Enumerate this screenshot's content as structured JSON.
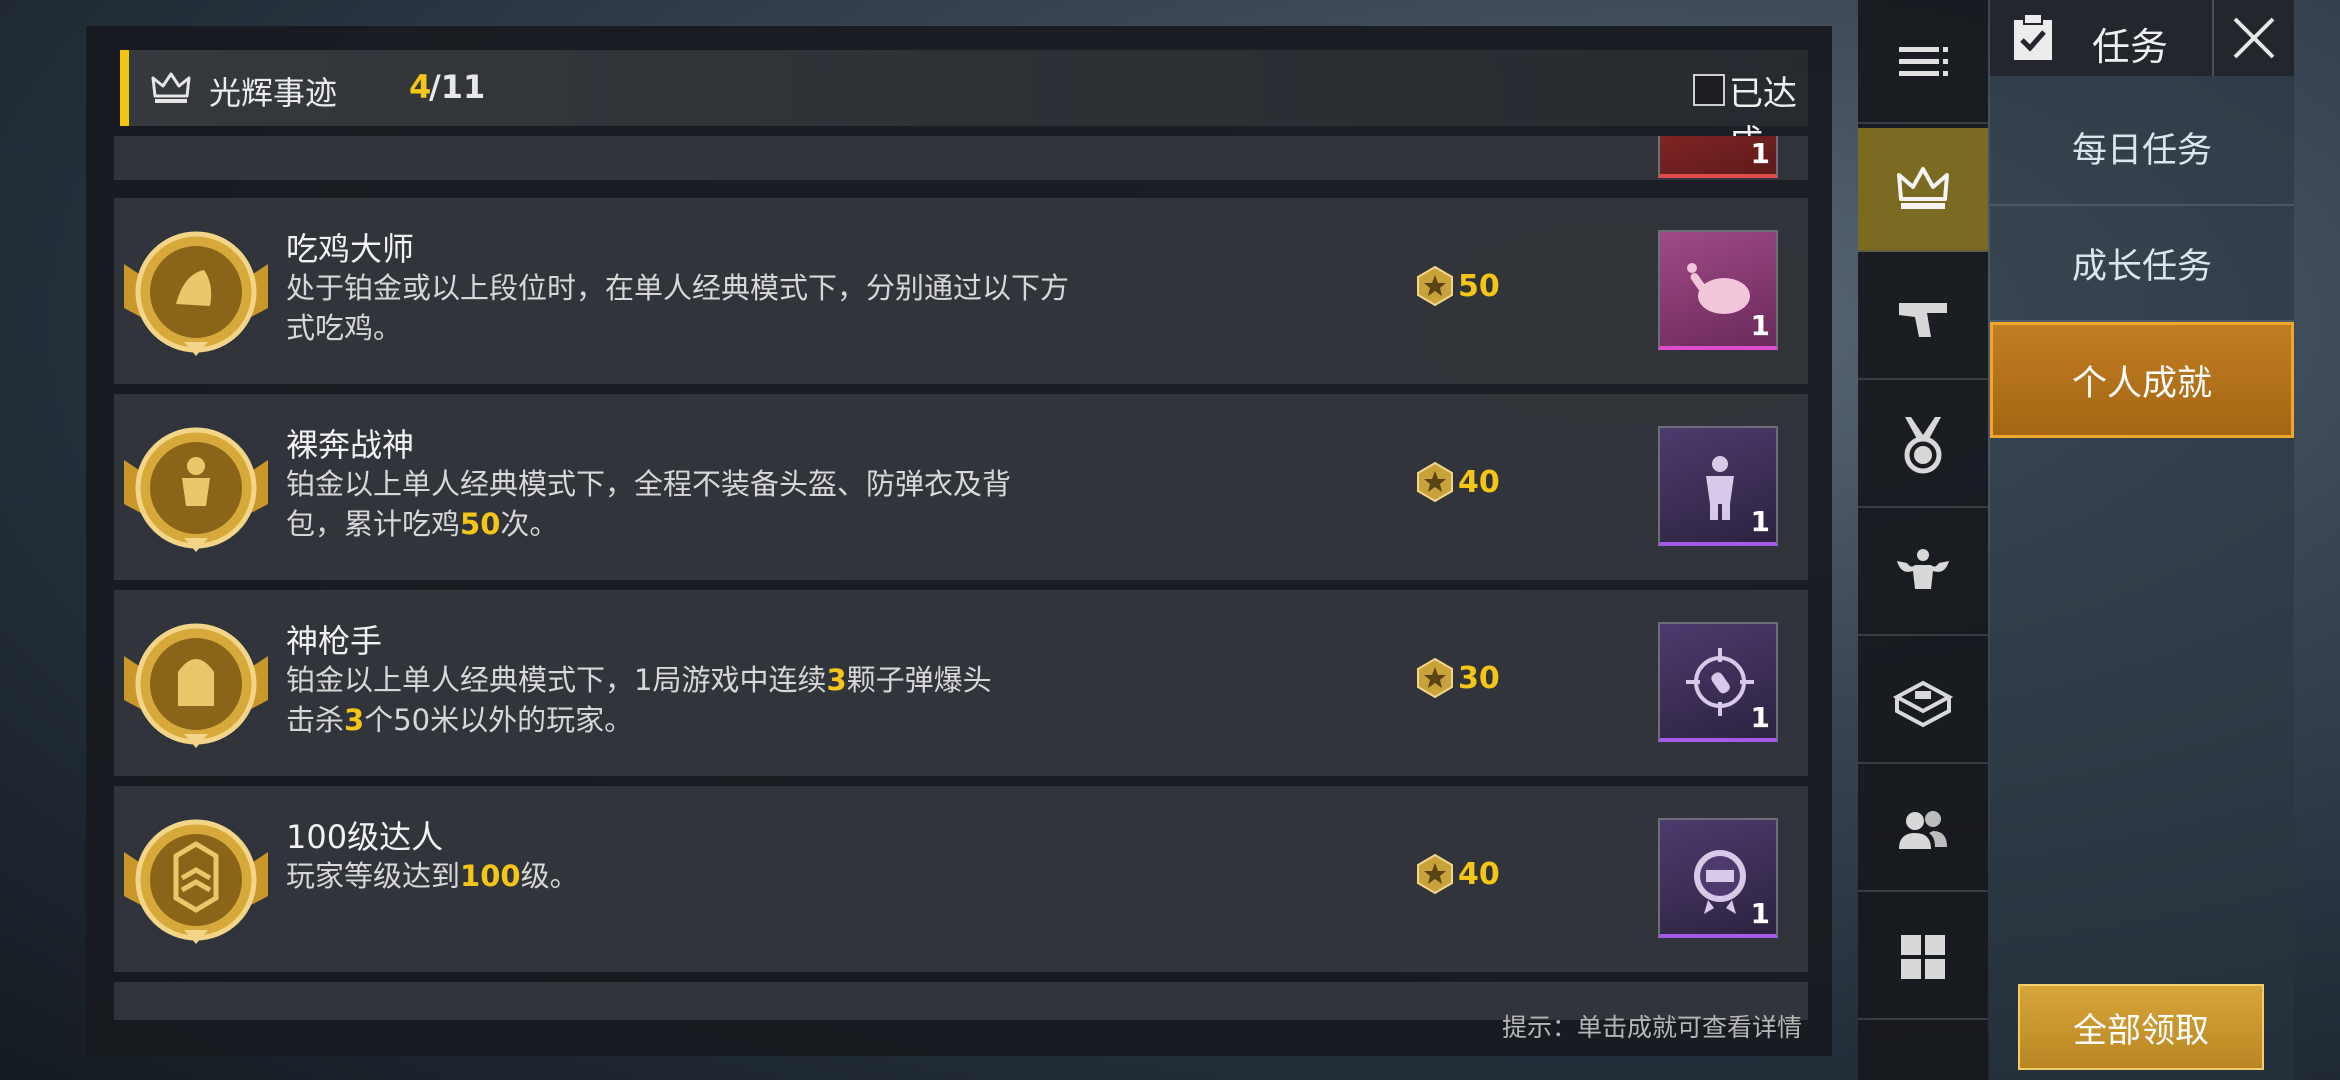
{
  "header": {
    "title": "光辉事迹",
    "progress_current": "4",
    "progress_total": "/11",
    "filter_label": "已达成"
  },
  "achievements": [
    {
      "title": "吃鸡大师",
      "desc_parts": [
        "处于铂金或以上段位时，在单人经典模式下，分别通过以下方式吃鸡。"
      ],
      "points": "50",
      "reward_count": "1",
      "reward_icon": "roast-chicken-icon",
      "reward_color": "#e04bd0"
    },
    {
      "title": "裸奔战神",
      "desc_parts": [
        "铂金以上单人经典模式下，全程不装备头盔、防弹衣及背包，累计吃鸡",
        "50",
        "次。"
      ],
      "points": "40",
      "reward_count": "1",
      "reward_icon": "bare-body-icon",
      "reward_color": "#a55be6"
    },
    {
      "title": "神枪手",
      "desc_parts": [
        "铂金以上单人经典模式下，1局游戏中连续",
        "3",
        "颗子弹爆头击杀",
        "3",
        "个50米以外的玩家。"
      ],
      "points": "30",
      "reward_count": "1",
      "reward_icon": "crosshair-bullet-icon",
      "reward_color": "#a55be6"
    },
    {
      "title": "100级达人",
      "desc_parts": [
        "玩家等级达到",
        "100",
        "级。"
      ],
      "points": "40",
      "reward_count": "1",
      "reward_icon": "level-100-badge-icon",
      "reward_color": "#a55be6"
    }
  ],
  "partial_top_reward_count": "1",
  "hint": "提示：单击成就可查看详情",
  "nav": [
    {
      "icon": "menu-lines-icon",
      "active": false
    },
    {
      "icon": "crown-icon",
      "active": true
    },
    {
      "icon": "pistol-icon",
      "active": false
    },
    {
      "icon": "medal-icon",
      "active": false
    },
    {
      "icon": "muscle-icon",
      "active": false
    },
    {
      "icon": "crate-icon",
      "active": false
    },
    {
      "icon": "friends-icon",
      "active": false
    },
    {
      "icon": "grid-icon",
      "active": false
    }
  ],
  "right_panel": {
    "title": "任务",
    "tabs": [
      "每日任务",
      "成长任务",
      "个人成就"
    ],
    "active_tab": "个人成就",
    "claim_all": "全部领取"
  },
  "colors": {
    "accent_gold": "#f5c518",
    "active_tab": "#c07e22",
    "nav_active": "#7a6a22"
  }
}
